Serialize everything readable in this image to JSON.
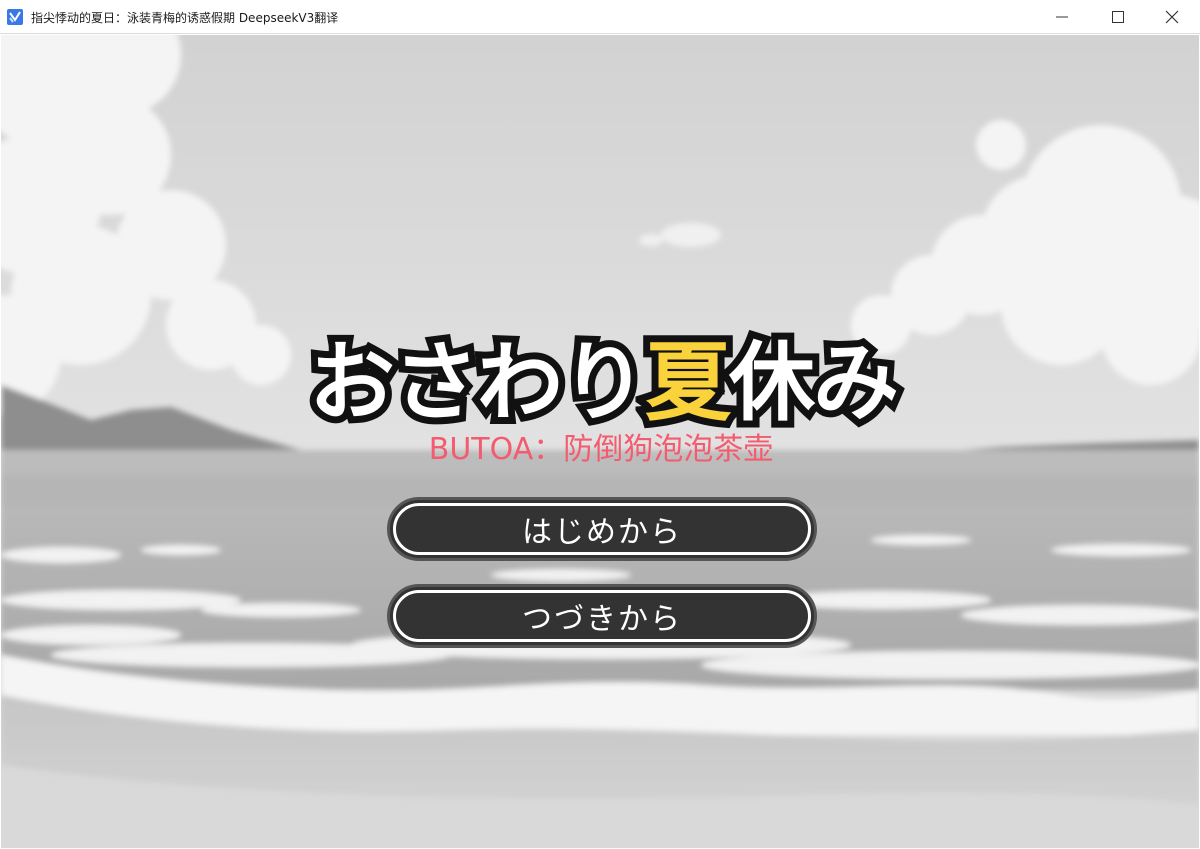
{
  "window": {
    "title": "指尖悸动的夏日：泳装青梅的诱惑假期 DeepseekV3翻译",
    "icon": "app-icon",
    "controls": [
      "minimize-icon",
      "maximize-icon",
      "close-icon"
    ]
  },
  "game": {
    "logo": {
      "part1": "おさわり",
      "accent": "夏",
      "part2": "休み",
      "accent_color": "#f9d23c"
    },
    "credit": "BUTOA：防倒狗泡泡茶壶",
    "credit_color": "#f25c6e",
    "menu": {
      "start": "はじめから",
      "continue": "つづきから"
    }
  }
}
